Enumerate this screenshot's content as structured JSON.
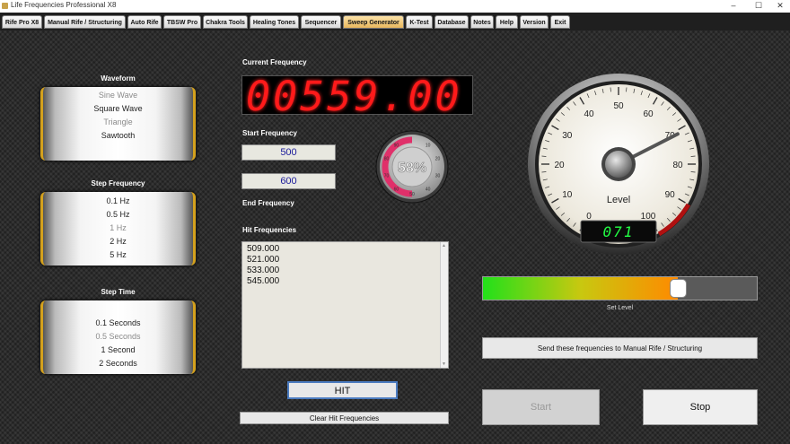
{
  "window": {
    "title": "Life Frequencies Professional X8",
    "min": "–",
    "max": "☐",
    "close": "✕"
  },
  "tabs": [
    {
      "label": "Rife Pro X8"
    },
    {
      "label": "Manual Rife / Structuring"
    },
    {
      "label": "Auto Rife"
    },
    {
      "label": "TBSW Pro"
    },
    {
      "label": "Chakra Tools"
    },
    {
      "label": "Healing Tones"
    },
    {
      "label": "Sequencer"
    },
    {
      "label": "Sweep Generator",
      "active": true
    },
    {
      "label": "K-Test"
    },
    {
      "label": "Database"
    },
    {
      "label": "Notes"
    },
    {
      "label": "Help"
    },
    {
      "label": "Version"
    },
    {
      "label": "Exit"
    }
  ],
  "waveform": {
    "label": "Waveform",
    "items": [
      "Sine Wave",
      "Square Wave",
      "Triangle",
      "Sawtooth"
    ]
  },
  "step_frequency": {
    "label": "Step Frequency",
    "items": [
      "0.1 Hz",
      "0.5 Hz",
      "1 Hz",
      "2 Hz",
      "5 Hz"
    ]
  },
  "step_time": {
    "label": "Step Time",
    "items": [
      "0.1 Seconds",
      "0.5 Seconds",
      "1 Second",
      "2 Seconds"
    ]
  },
  "current_frequency": {
    "label": "Current Frequency",
    "value": "00559.00"
  },
  "start_frequency": {
    "label": "Start Frequency",
    "value": "500"
  },
  "end_frequency": {
    "label": "End Frequency",
    "value": "600"
  },
  "progress_dial": {
    "text": "58%",
    "value": 0.58,
    "ticks": [
      "10",
      "20",
      "30",
      "40",
      "50",
      "60",
      "70",
      "80",
      "90"
    ]
  },
  "gauge": {
    "ticks": [
      "0",
      "10",
      "20",
      "30",
      "40",
      "50",
      "60",
      "70",
      "80",
      "90",
      "100"
    ],
    "label": "Level",
    "readout": "071",
    "value": 71,
    "accent": "#b01010"
  },
  "hit_frequencies": {
    "label": "Hit Frequencies",
    "items": [
      "509.000",
      "521.000",
      "533.000",
      "545.000"
    ]
  },
  "hit_button": "HIT",
  "clear_button": "Clear Hit Frequencies",
  "level_slider": {
    "label": "Set Level",
    "value": 0.71
  },
  "send_button": "Send these frequencies to Manual Rife / Structuring",
  "start_button": "Start",
  "stop_button": "Stop",
  "colors": {
    "led": "#ff1a1a",
    "gold": "#d4a11d",
    "readout": "#22ff44"
  }
}
